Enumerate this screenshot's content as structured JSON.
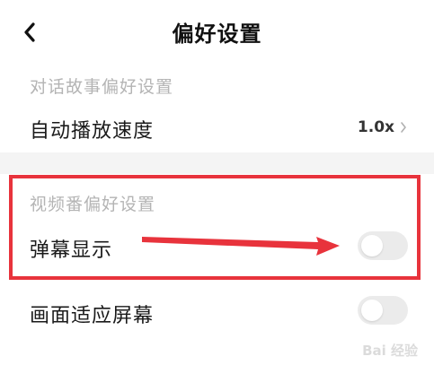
{
  "header": {
    "title": "偏好设置"
  },
  "sections": {
    "dialog_story": {
      "title": "对话故事偏好设置",
      "autoplay_speed": {
        "label": "自动播放速度",
        "value": "1.0x"
      }
    },
    "video_channel": {
      "title": "视频番偏好设置",
      "danmaku": {
        "label": "弹幕显示",
        "enabled": false
      },
      "fit_screen": {
        "label": "画面适应屏幕",
        "enabled": false
      }
    }
  },
  "annotation": {
    "color": "#e8333c"
  },
  "watermark": {
    "text": "Bai 经验"
  },
  "icons": {
    "back": "chevron-left-icon",
    "value_arrow": "chevron-right-icon"
  }
}
